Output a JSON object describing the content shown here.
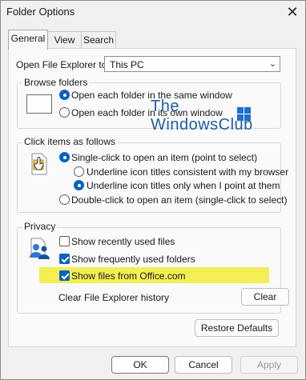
{
  "window": {
    "title": "Folder Options",
    "close_glyph": "✕"
  },
  "tabs": [
    {
      "label": "General",
      "active": true
    },
    {
      "label": "View",
      "active": false
    },
    {
      "label": "Search",
      "active": false
    }
  ],
  "open_explorer": {
    "label": "Open File Explorer to:",
    "value": "This PC"
  },
  "browse_folders": {
    "legend": "Browse folders",
    "options": [
      {
        "label": "Open each folder in the same window",
        "selected": true
      },
      {
        "label": "Open each folder in its own window",
        "selected": false
      }
    ]
  },
  "click_items": {
    "legend": "Click items as follows",
    "single_click": {
      "label": "Single-click to open an item (point to select)",
      "selected": true
    },
    "underline_browser": {
      "label": "Underline icon titles consistent with my browser",
      "selected": false
    },
    "underline_point": {
      "label": "Underline icon titles only when I point at them",
      "selected": true
    },
    "double_click": {
      "label": "Double-click to open an item (single-click to select)",
      "selected": false
    }
  },
  "privacy": {
    "legend": "Privacy",
    "items": [
      {
        "label": "Show recently used files",
        "checked": false
      },
      {
        "label": "Show frequently used folders",
        "checked": true
      },
      {
        "label": "Show files from Office.com",
        "checked": true
      }
    ],
    "highlight_color": "#f2ee53",
    "clear_history_label": "Clear File Explorer history",
    "clear_button": "Clear"
  },
  "restore_defaults": "Restore Defaults",
  "footer": {
    "ok": "OK",
    "cancel": "Cancel",
    "apply": "Apply"
  },
  "watermark": {
    "line1": "The",
    "line2": "WindowsClub"
  },
  "colors": {
    "accent": "#0a62c2",
    "background": "#f0f0f0",
    "panel": "#fafafa"
  }
}
